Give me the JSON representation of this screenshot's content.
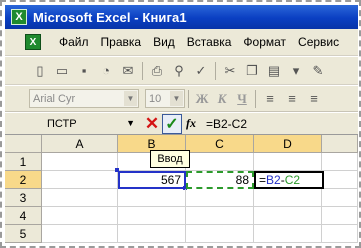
{
  "window": {
    "title": "Microsoft Excel - Книга1"
  },
  "menu": {
    "items": [
      "Файл",
      "Правка",
      "Вид",
      "Вставка",
      "Формат",
      "Сервис"
    ]
  },
  "toolbar_standard": {
    "icons": [
      "new-icon",
      "open-icon",
      "save-icon",
      "permission-icon",
      "email-icon",
      "print-icon",
      "print-preview-icon",
      "spelling-icon",
      "cut-icon",
      "copy-icon",
      "paste-icon",
      "format-painter-icon"
    ]
  },
  "toolbar_formatting": {
    "font": "Arial Cyr",
    "size": "10",
    "bold": "Ж",
    "italic": "К",
    "underline": "Ч"
  },
  "formula_bar": {
    "name_box": "ПСТР",
    "fx": "fx",
    "formula": "=B2-C2"
  },
  "tooltip": "Ввод",
  "grid": {
    "columns": [
      "A",
      "B",
      "C",
      "D"
    ],
    "rows": [
      "1",
      "2",
      "3",
      "4",
      "5"
    ],
    "cells": {
      "B2": "567",
      "C2": "88",
      "D2_eq": "=",
      "D2_ref1": "B2",
      "D2_minus": "-",
      "D2_ref2": "C2"
    }
  }
}
